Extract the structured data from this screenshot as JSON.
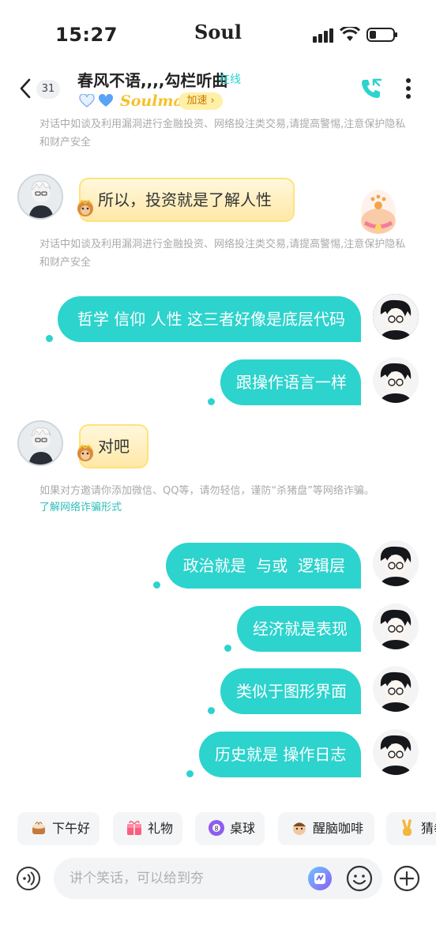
{
  "status_bar": {
    "time": "15:27",
    "brand": "Soul"
  },
  "header": {
    "title": "春风不语,,,,勾栏听曲",
    "online": "在线",
    "unread_count": "31",
    "soulmate_label": "Soulmate",
    "boost_label": "加速 ›",
    "colors": {
      "accent": "#2dd3cd",
      "gold": "#f5c12b"
    }
  },
  "notices": {
    "finance_warning": "对话中如谈及利用漏洞进行金融投资、网络投注类交易,请提高警惕,注意保护隐私和财产安全",
    "wechat_warning": "如果对方邀请你添加微信、QQ等，请勿轻信，谨防“杀猪盘”等网络诈骗。",
    "learn_more": "了解网络诈骗形式"
  },
  "messages": {
    "m1": "所以，投资就是了解人性",
    "m2": "哲学 信仰 人性 这三者好像是底层代码",
    "m3": "跟操作语言一样",
    "m4": "对吧",
    "m5": "政治就是  与或  逻辑层",
    "m6": "经济就是表现",
    "m7": "类似于图形界面",
    "m8": "历史就是 操作日志"
  },
  "quick_replies": {
    "q1": "下午好",
    "q2": "礼物",
    "q3": "桌球",
    "q4": "醒脑咖啡",
    "q5": "猜拳"
  },
  "composer": {
    "placeholder": "讲个笑话，可以给到夯"
  }
}
